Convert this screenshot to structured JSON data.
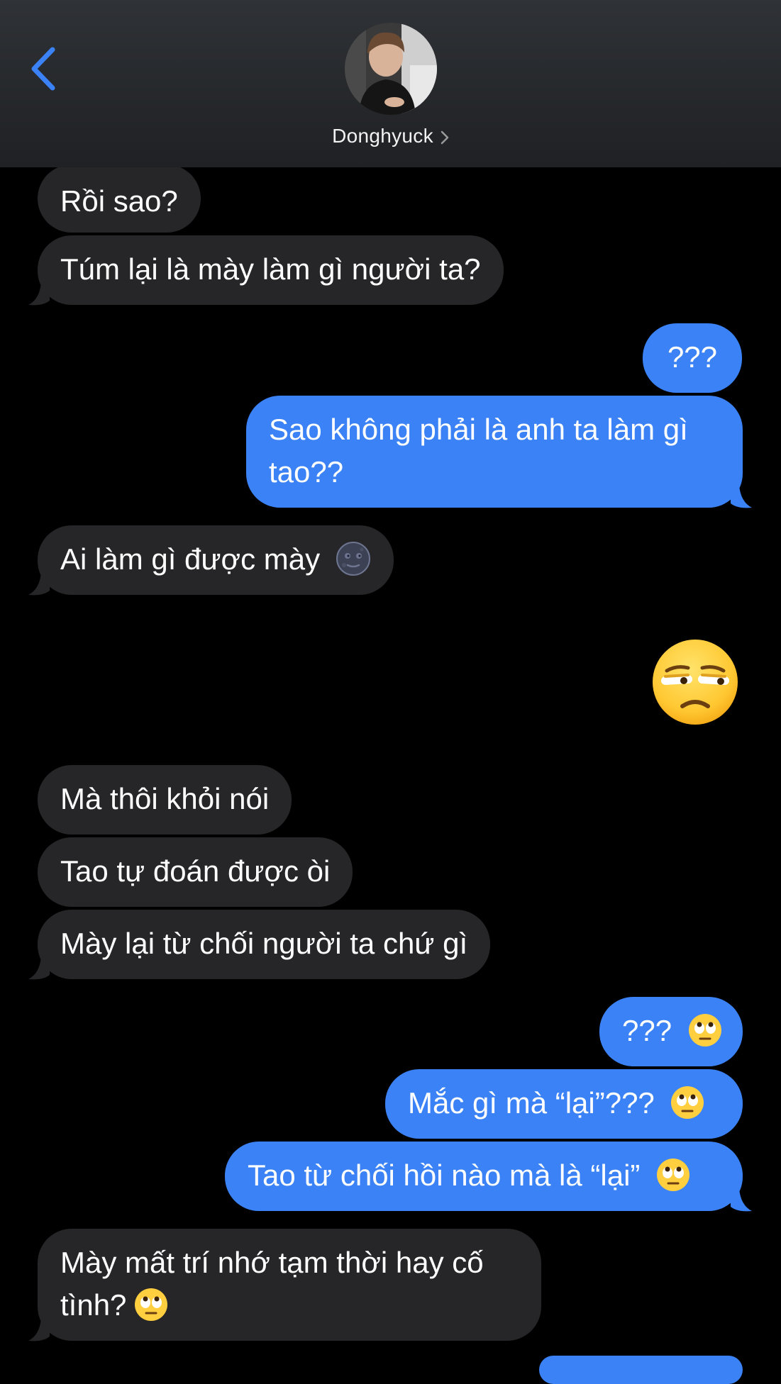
{
  "header": {
    "contact_name": "Donghyuck",
    "avatar_alt": "Donghyuck avatar",
    "icons": {
      "back": "chevron-left-icon",
      "disclosure": "chevron-right-icon"
    }
  },
  "messages": [
    {
      "side": "received",
      "text": "Rồi sao?"
    },
    {
      "side": "received",
      "text": "Túm lại là mày làm gì người ta?"
    },
    {
      "side": "sent",
      "text": "???"
    },
    {
      "side": "sent",
      "line1": "Sao không phải là anh ta làm gì",
      "line2": "tao??"
    },
    {
      "side": "received",
      "text": "Ai làm gì được mày",
      "emoji": "new-moon-face"
    },
    {
      "side": "sent",
      "emoji": "unamused-face"
    },
    {
      "side": "received",
      "text": "Mà thôi khỏi nói"
    },
    {
      "side": "received",
      "text": "Tao tự đoán được òi"
    },
    {
      "side": "received",
      "text": "Mày lại từ chối người ta chứ gì"
    },
    {
      "side": "sent",
      "text": "???",
      "emoji": "face-with-rolling-eyes"
    },
    {
      "side": "sent",
      "text": "Mắc gì mà “lại”???",
      "emoji": "face-with-rolling-eyes"
    },
    {
      "side": "sent",
      "text": "Tao từ chối hồi nào mà là “lại”",
      "emoji": "face-with-rolling-eyes"
    },
    {
      "side": "received",
      "line1": "Mày mất trí nhớ tạm thời hay cố",
      "line2": "tình?",
      "emoji": "face-with-rolling-eyes"
    }
  ],
  "colors": {
    "received_bubble": "#262628",
    "sent_bubble": "#3b82f6",
    "accent": "#3b82f6",
    "background": "#000000"
  }
}
